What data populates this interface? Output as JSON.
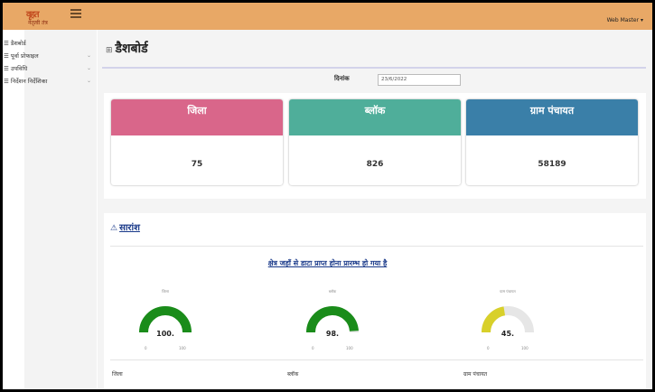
{
  "header": {
    "logo_line1": "वृहत",
    "logo_line2": "नेतृत्वी तंत्र",
    "user_label": "Web Master ▾"
  },
  "sidebar": {
    "items": [
      {
        "label": "डैशबोर्ड",
        "has_chevron": false
      },
      {
        "label": "पूर्वा प्रोफाइल",
        "has_chevron": true
      },
      {
        "label": "उपविधि",
        "has_chevron": true
      },
      {
        "label": "निर्देशन निर्देशिका",
        "has_chevron": true
      }
    ]
  },
  "page": {
    "title": "डैशबोर्ड",
    "date_label": "दिनांक",
    "date_value": "23/6/2022"
  },
  "cards": [
    {
      "title": "जिला",
      "value": "75",
      "color": "#d9668a"
    },
    {
      "title": "ब्लॉक",
      "value": "826",
      "color": "#4fae9a"
    },
    {
      "title": "ग्राम पंचायत",
      "value": "58189",
      "color": "#3a7fa8"
    }
  ],
  "summary": {
    "title": "सारांश",
    "subheading": "क्षेत्र जहाँ से डाटा प्राप्त होना प्रारम्भ हो गया है",
    "gauges": [
      {
        "caption": "जिला",
        "value": 100,
        "display": "100",
        "color": "#1a8c1a",
        "min": "0",
        "max": "100"
      },
      {
        "caption": "ब्लॉक",
        "value": 98,
        "display": "98",
        "color": "#1a8c1a",
        "min": "0",
        "max": "100"
      },
      {
        "caption": "ग्राम पंचायत",
        "value": 45,
        "display": "45",
        "color": "#d8d02a",
        "min": "0",
        "max": "100"
      }
    ],
    "bottom_labels": [
      "जिला",
      "ब्लॉक",
      "ग्राम पंचायत"
    ]
  }
}
